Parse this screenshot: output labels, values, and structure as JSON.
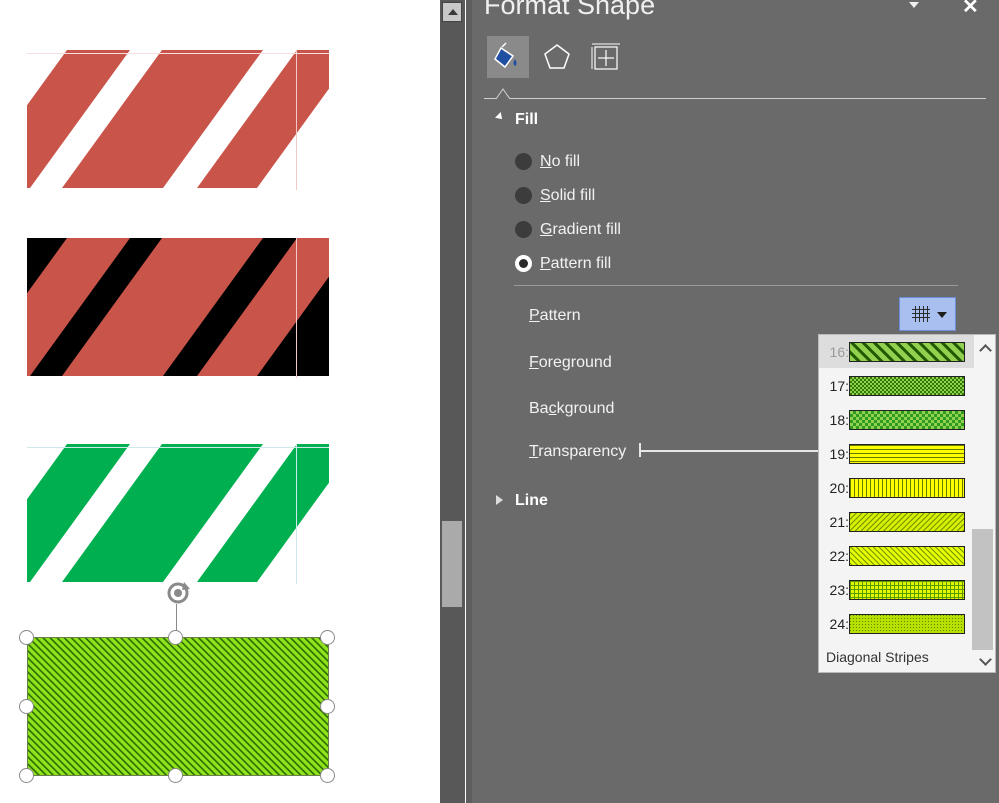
{
  "pane": {
    "title": "Format Shape",
    "tabs": [
      {
        "name": "Fill & Line",
        "icon": "paint-bucket-icon"
      },
      {
        "name": "Effects",
        "icon": "pentagon-icon"
      },
      {
        "name": "Size & Properties",
        "icon": "size-properties-icon"
      }
    ],
    "fill_section": {
      "label": "Fill",
      "options": [
        {
          "label_underline": "N",
          "label_rest": "o fill",
          "selected": false
        },
        {
          "label_underline": "S",
          "label_rest": "olid fill",
          "selected": false
        },
        {
          "label_underline": "G",
          "label_rest": "radient fill",
          "selected": false
        },
        {
          "label_underline": "P",
          "label_rest": "attern fill",
          "selected": true
        }
      ],
      "pattern_label": {
        "pre": "",
        "u": "P",
        "post": "attern"
      },
      "foreground_label": {
        "pre": "",
        "u": "F",
        "post": "oreground"
      },
      "background_label": {
        "pre": "Ba",
        "u": "c",
        "post": "kground"
      },
      "transparency_label": {
        "pre": "",
        "u": "T",
        "post": "ransparency"
      }
    },
    "line_section": {
      "label": "Line"
    }
  },
  "pattern_dropdown": {
    "items": [
      {
        "num": "16:",
        "pattern": "wide-upward-diagonal",
        "highlighted": true
      },
      {
        "num": "17:",
        "pattern": "small-checker"
      },
      {
        "num": "18:",
        "pattern": "large-checker"
      },
      {
        "num": "19:",
        "pattern": "narrow-horizontal"
      },
      {
        "num": "20:",
        "pattern": "narrow-vertical"
      },
      {
        "num": "21:",
        "pattern": "light-downward-diagonal"
      },
      {
        "num": "22:",
        "pattern": "light-upward-diagonal"
      },
      {
        "num": "23:",
        "pattern": "small-grid"
      },
      {
        "num": "24:",
        "pattern": "dotted-grid"
      }
    ],
    "tooltip": "Diagonal Stripes"
  },
  "canvas": {
    "shapes": [
      {
        "name": "red-white-stripes",
        "fg": "#c9544a",
        "bg": "#ffffff"
      },
      {
        "name": "red-black-stripes",
        "fg": "#c9544a",
        "bg": "#000000"
      },
      {
        "name": "green-white-stripes",
        "fg": "#00b050",
        "bg": "#ffffff"
      },
      {
        "name": "lime-pattern-selected",
        "fg": "#2e6a00",
        "bg": "#8fe31c"
      }
    ]
  },
  "colors": {
    "pane_bg": "#6a6a6a",
    "accent": "#a9bff0",
    "swatch_green": "#92d050",
    "swatch_yellow": "#ffff00"
  }
}
